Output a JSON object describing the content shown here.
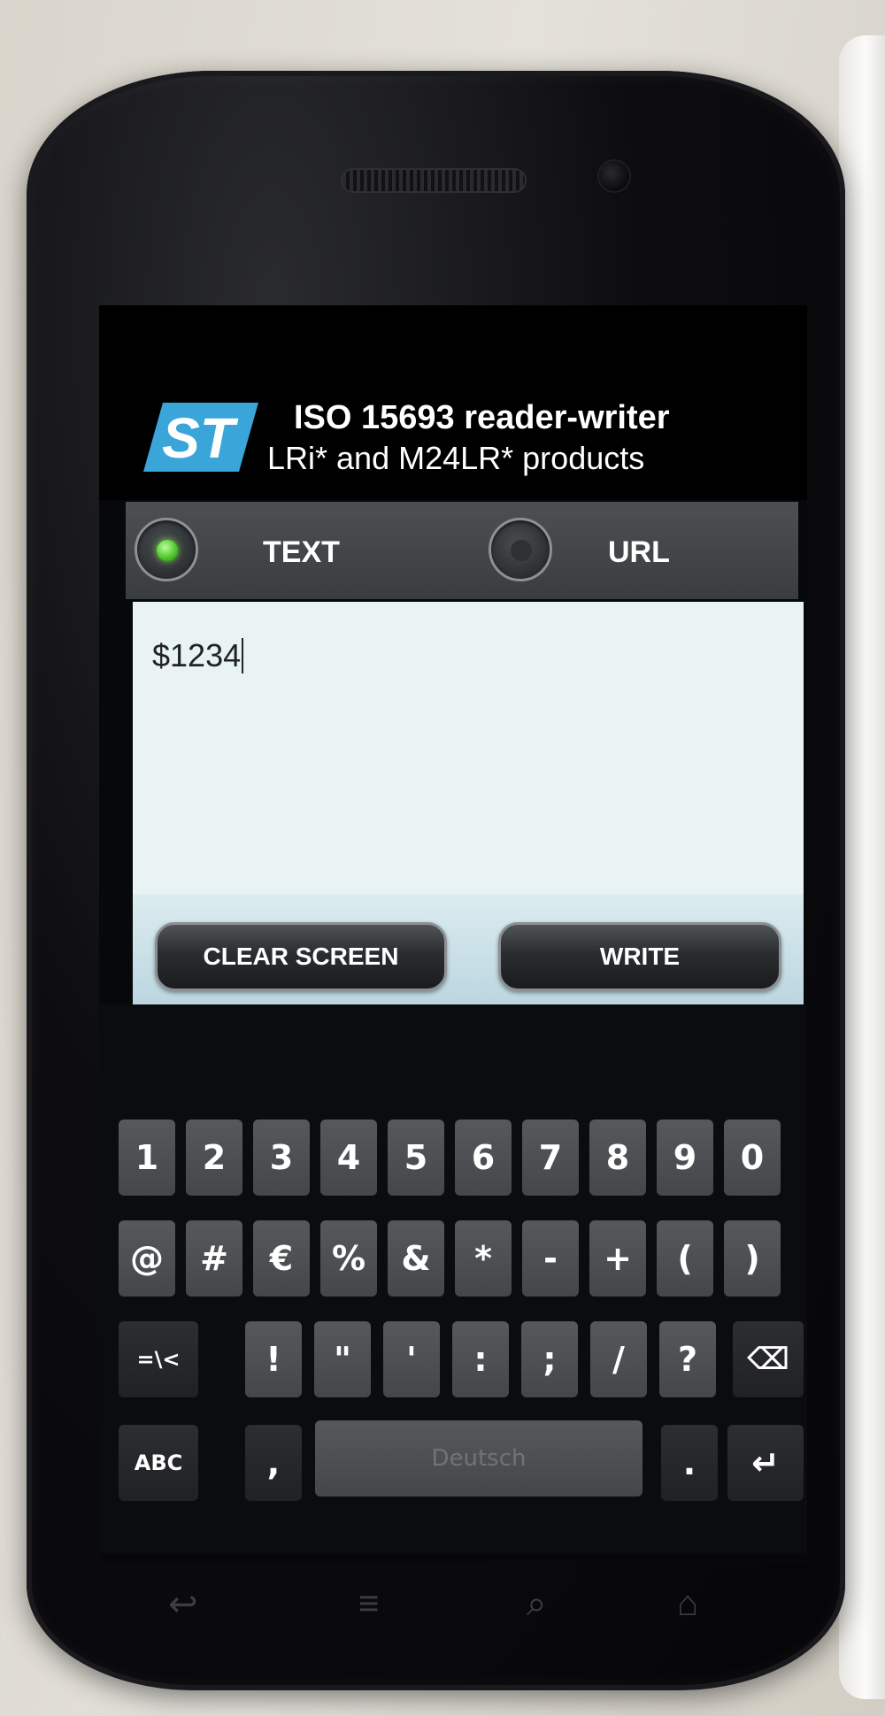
{
  "header": {
    "title_line1": "ISO 15693 reader-writer",
    "title_line2": "LRi* and M24LR* products",
    "logo_text": "ST"
  },
  "mode": {
    "text_label": "TEXT",
    "url_label": "URL",
    "selected": "TEXT"
  },
  "editor": {
    "value": "$1234"
  },
  "buttons": {
    "clear_label": "CLEAR SCREEN",
    "write_label": "WRITE"
  },
  "keyboard": {
    "row1": [
      "1",
      "2",
      "3",
      "4",
      "5",
      "6",
      "7",
      "8",
      "9",
      "0"
    ],
    "row2": [
      "@",
      "#",
      "€",
      "%",
      "&",
      "*",
      "-",
      "+",
      "(",
      ")"
    ],
    "row3": [
      "=\\<",
      "!",
      "\"",
      "'",
      ":",
      ";",
      "/",
      "?",
      "⌫"
    ],
    "row4": [
      "ABC",
      ",",
      "Deutsch",
      ".",
      "↵"
    ]
  },
  "colors": {
    "accent_green": "#4cc225",
    "editor_bg": "#e9f3f4"
  }
}
